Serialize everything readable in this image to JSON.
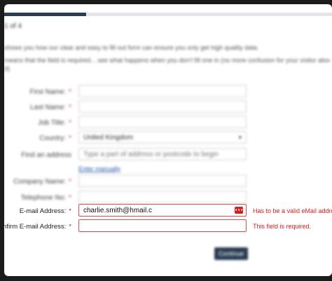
{
  "step_label": "1 of 4",
  "progress": 0.25,
  "intro": {
    "line1": "shows you how our clear and easy to fill out form can ensure you only get high quality data.",
    "line2": "means that the field is required... see what happens when you don't fill one in (no more confusion for your visitor about what they're",
    "line3": "d)"
  },
  "fields": {
    "first_name": {
      "label": "First Name:",
      "value": ""
    },
    "last_name": {
      "label": "Last Name:",
      "value": ""
    },
    "job_title": {
      "label": "Job Title:",
      "value": ""
    },
    "country": {
      "label": "Country:",
      "value": "United Kingdom"
    },
    "address": {
      "label": "Find an address",
      "placeholder": "Type a part of address or postcode to begin"
    },
    "enter_manually": "Enter manually",
    "company": {
      "label": "Company Name:",
      "value": ""
    },
    "telephone": {
      "label": "Telephone No:",
      "value": ""
    },
    "email": {
      "label": "E-mail Address:",
      "value": "charlie.smith@hmail.c",
      "error": "Has to be a valid eMail address"
    },
    "confirm_email": {
      "label": "Confirm E-mail Address:",
      "value": "",
      "error": "This field is required."
    }
  },
  "required_mark": "*",
  "continue_label": "Continue",
  "colors": {
    "accent": "#2a3d55",
    "error": "#d32020",
    "link": "#2a57a8"
  }
}
